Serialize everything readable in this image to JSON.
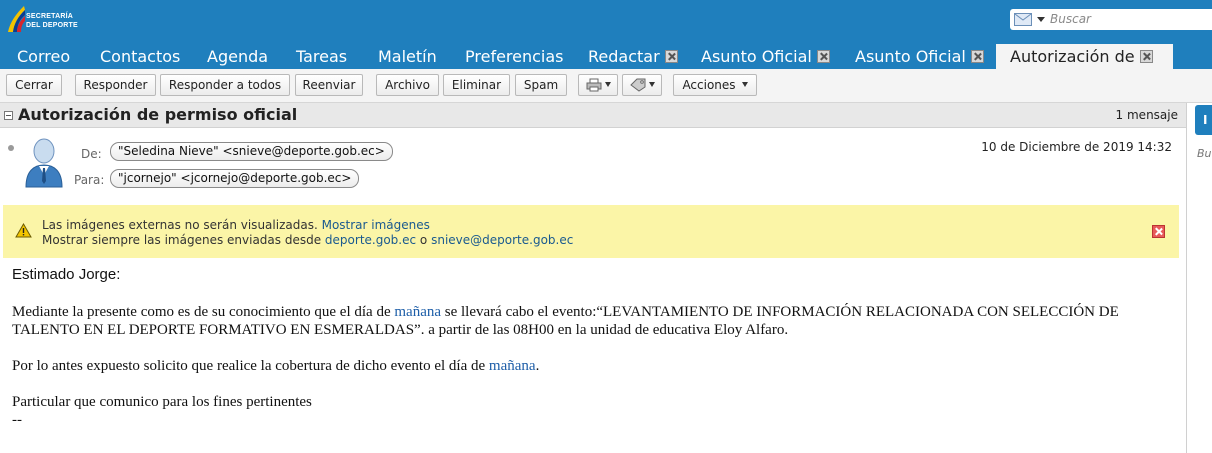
{
  "logo": {
    "line1": "SECRETARÍA",
    "line2": "DEL DEPORTE"
  },
  "search": {
    "placeholder": "Buscar",
    "icon": "mail-icon"
  },
  "tabs": [
    {
      "label": "Correo"
    },
    {
      "label": "Contactos"
    },
    {
      "label": "Agenda"
    },
    {
      "label": "Tareas"
    },
    {
      "label": "Maletín"
    },
    {
      "label": "Preferencias"
    },
    {
      "label": "Redactar",
      "closable": true
    },
    {
      "label": "Asunto Oficial",
      "closable": true
    },
    {
      "label": "Asunto Oficial",
      "closable": true
    },
    {
      "label": "Autorización de",
      "closable": true,
      "active": true
    }
  ],
  "toolbar": {
    "close": "Cerrar",
    "reply": "Responder",
    "reply_all": "Responder a todos",
    "forward": "Reenviar",
    "archive": "Archivo",
    "delete": "Eliminar",
    "spam": "Spam",
    "actions": "Acciones"
  },
  "message": {
    "subject": "Autorización de permiso oficial",
    "count": "1 mensaje",
    "from_label": "De:",
    "from": "\"Seledina Nieve\" <snieve@deporte.gob.ec>",
    "to_label": "Para:",
    "to": "\"jcornejo\" <jcornejo@deporte.gob.ec>",
    "date": "10 de Diciembre de 2019 14:32"
  },
  "warning": {
    "line1": "Las imágenes externas no serán visualizadas.",
    "show_images": "Mostrar imágenes",
    "line2": "Mostrar siempre las imágenes enviadas desde",
    "domain": "deporte.gob.ec",
    "or": "o",
    "sender": "snieve@deporte.gob.ec"
  },
  "body": {
    "greeting": "Estimado Jorge:",
    "p1_a": "Mediante la presente como es de su conocimiento que el día de ",
    "p1_link": "mañana",
    "p1_b": " se llevará cabo el evento:“LEVANTAMIENTO DE INFORMACIÓN RELACIONADA CON SELECCIÓN DE TALENTO EN EL DEPORTE FORMATIVO EN ESMERALDAS”.  a partir de las 08H00 en la unidad de educativa Eloy Alfaro.",
    "p2_a": "Por lo antes expuesto solicito que realice la cobertura de dicho evento el día de ",
    "p2_link": "mañana",
    "p2_b": ".",
    "p3": "Particular que comunico para los fines pertinentes",
    "sig": "--"
  },
  "sidebar": {
    "button": "I",
    "text": "Bu"
  },
  "colors": {
    "header": "#1f7fbd",
    "warning": "#fbf5a7",
    "link": "#1a5a8f"
  }
}
